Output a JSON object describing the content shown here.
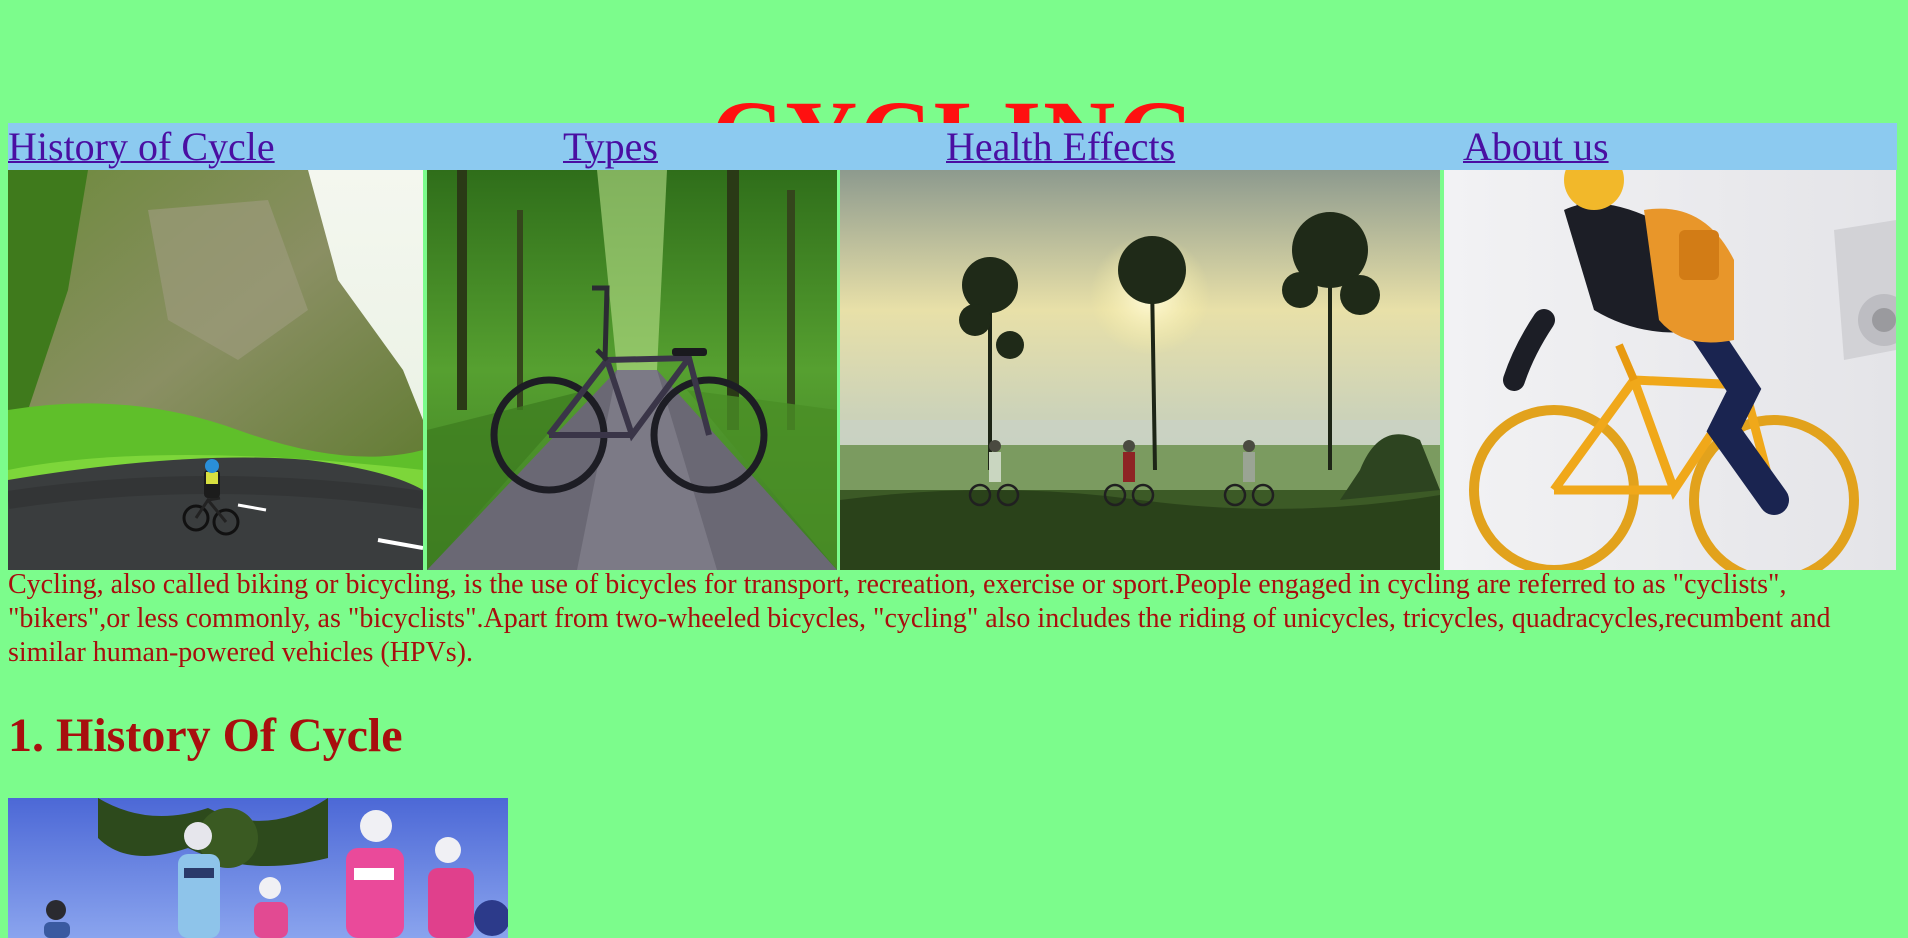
{
  "page": {
    "title": "CYCLING",
    "background_color": "#7cfc8c",
    "title_color": "#ff1010",
    "text_color": "#a80e0e"
  },
  "nav": {
    "background_color": "#8ccaf0",
    "link_color": "#4a0fa2",
    "items": [
      {
        "label": "History of Cycle"
      },
      {
        "label": "Types"
      },
      {
        "label": "Health Effects"
      },
      {
        "label": "About us"
      }
    ]
  },
  "gallery": {
    "images": [
      {
        "name": "mountain-road-cyclist-photo"
      },
      {
        "name": "parked-bicycle-forest-road-photo"
      },
      {
        "name": "sunrise-field-cyclists-photo"
      },
      {
        "name": "yellow-bike-rider-photo"
      }
    ]
  },
  "intro": {
    "text": "Cycling, also called biking or bicycling, is the use of bicycles for transport, recreation, exercise or sport.People engaged in cycling are referred to as \"cyclists\", \"bikers\",or less commonly, as \"bicyclists\".Apart from two-wheeled bicycles, \"cycling\" also includes the riding of unicycles, tricycles, quadracycles,recumbent and similar human-powered vehicles (HPVs)."
  },
  "history": {
    "heading": "1. History Of Cycle",
    "image": {
      "name": "group-road-cyclists-photo"
    }
  }
}
